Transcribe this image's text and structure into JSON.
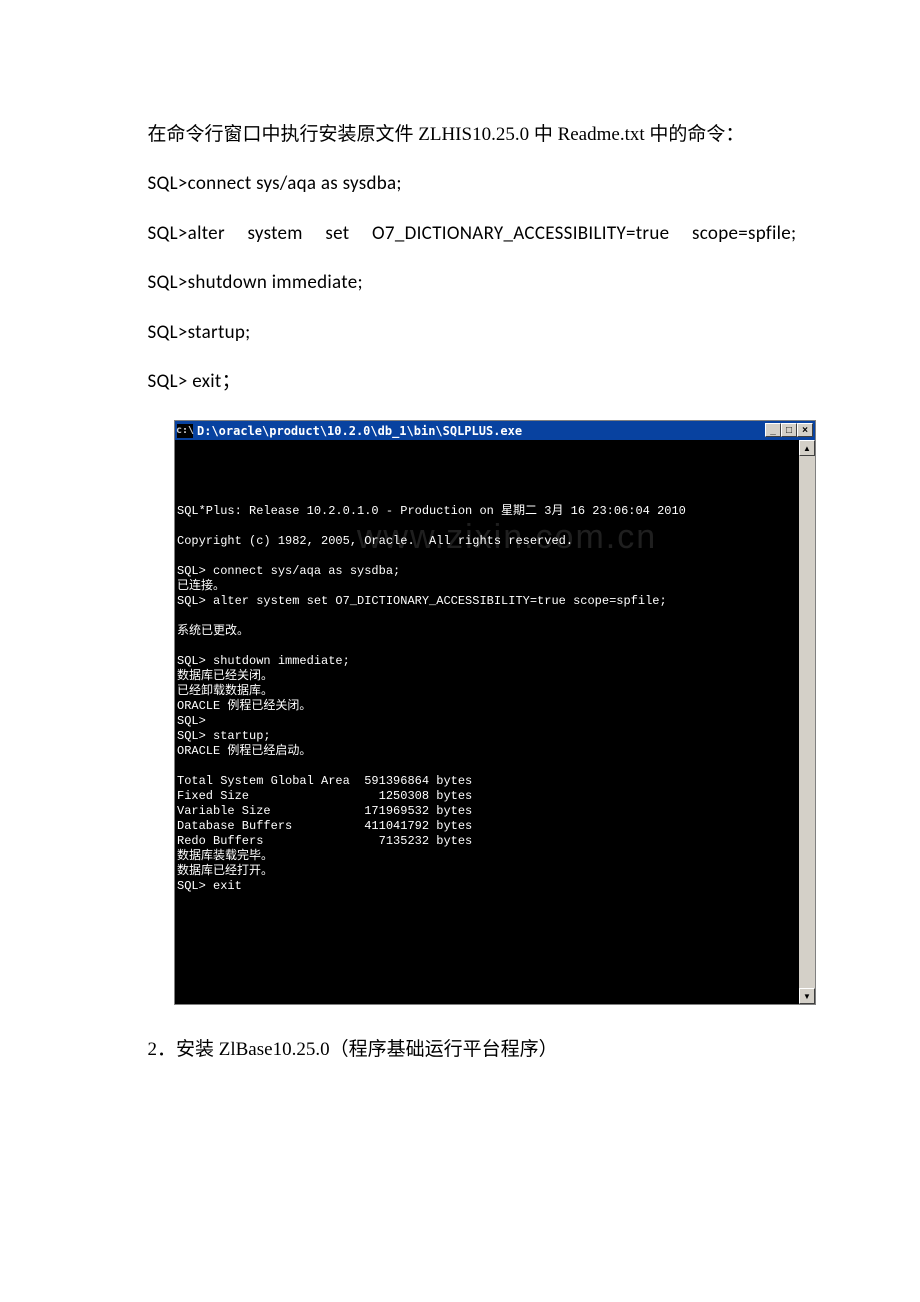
{
  "doc": {
    "intro": "在命令行窗口中执行安装原文件 ZLHIS10.25.0 中 Readme.txt 中的命令：",
    "cmd1": "SQL>connect   sys/aqa   as   sysdba;",
    "cmd2": "SQL>alter     system     set     O7_DICTIONARY_ACCESSIBILITY=true scope=spfile;",
    "cmd3": "SQL>shutdown   immediate;",
    "cmd4": "SQL>startup;",
    "cmd5": "SQL> exit；",
    "step2": "2．安装 ZlBase10.25.0（程序基础运行平台程序）"
  },
  "console": {
    "titlebar_icon": "c:\\",
    "title": "D:\\oracle\\product\\10.2.0\\db_1\\bin\\SQLPLUS.exe",
    "min": "_",
    "max": "□",
    "close": "×",
    "scroll_up": "▲",
    "scroll_down": "▼",
    "lines": [
      "",
      "SQL*Plus: Release 10.2.0.1.0 - Production on 星期二 3月 16 23:06:04 2010",
      "",
      "Copyright (c) 1982, 2005, Oracle.  All rights reserved.",
      "",
      "SQL> connect sys/aqa as sysdba;",
      "已连接。",
      "SQL> alter system set O7_DICTIONARY_ACCESSIBILITY=true scope=spfile;",
      "",
      "系统已更改。",
      "",
      "SQL> shutdown immediate;",
      "数据库已经关闭。",
      "已经卸载数据库。",
      "ORACLE 例程已经关闭。",
      "SQL>",
      "SQL> startup;",
      "ORACLE 例程已经启动。",
      "",
      "Total System Global Area  591396864 bytes",
      "Fixed Size                  1250308 bytes",
      "Variable Size             171969532 bytes",
      "Database Buffers          411041792 bytes",
      "Redo Buffers                7135232 bytes",
      "数据库装载完毕。",
      "数据库已经打开。",
      "SQL> exit"
    ],
    "watermark": "www.zixin.com.cn"
  }
}
